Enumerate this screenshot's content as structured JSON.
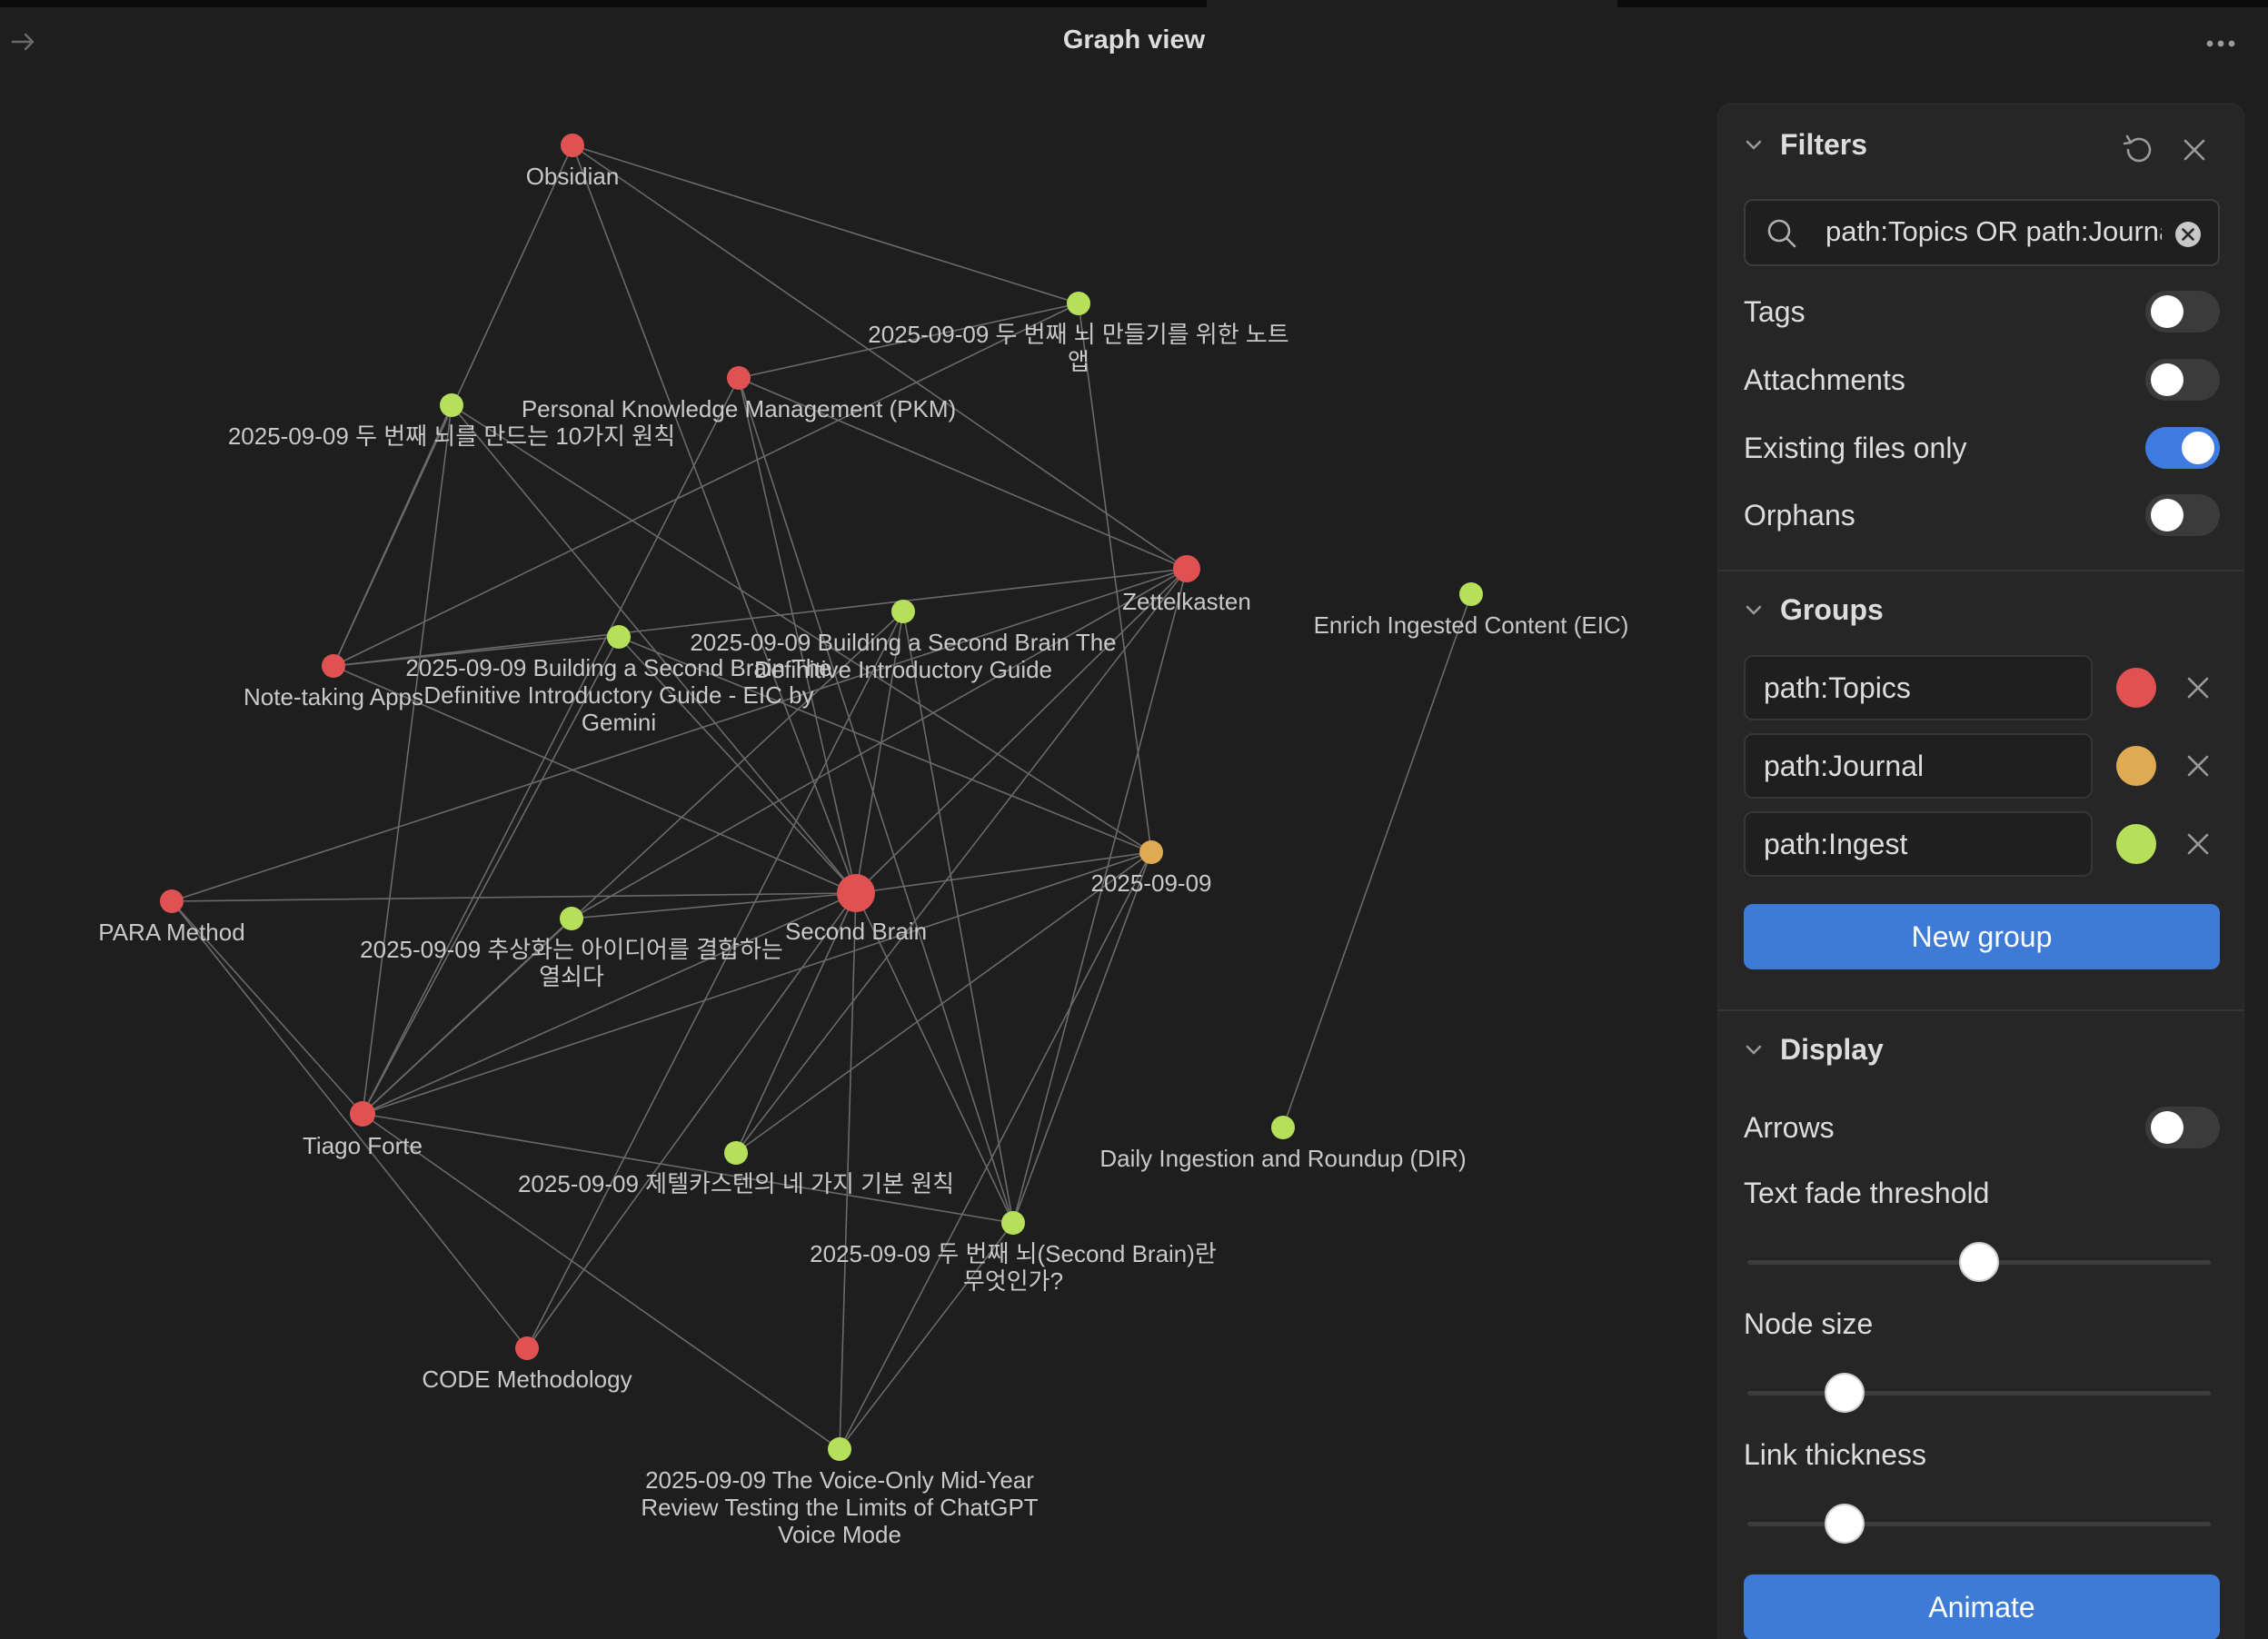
{
  "header": {
    "title": "Graph view"
  },
  "colors": {
    "topics": "#e05252",
    "journal": "#e0aa52",
    "ingest": "#b6e05a",
    "accent": "#3e7bd7",
    "edge": "#6a6a6a"
  },
  "graph": {
    "nodes": [
      {
        "id": "obsidian",
        "label": [
          "Obsidian"
        ],
        "group": "topics"
      },
      {
        "id": "second_brain_app",
        "label": [
          "2025-09-09 두 번째 뇌 만들기를 위한 노트",
          "앱"
        ],
        "group": "ingest"
      },
      {
        "id": "pkm",
        "label": [
          "Personal Knowledge Management (PKM)"
        ],
        "group": "topics"
      },
      {
        "id": "ten_principles",
        "label": [
          "2025-09-09 두 번째 뇌를 만드는 10가지 원칙"
        ],
        "group": "ingest"
      },
      {
        "id": "zettelkasten",
        "label": [
          "Zettelkasten"
        ],
        "group": "topics"
      },
      {
        "id": "eic",
        "label": [
          "Enrich Ingested Content (EIC)"
        ],
        "group": "ingest"
      },
      {
        "id": "bsb_intro",
        "label": [
          "2025-09-09 Building a Second Brain The",
          "Definitive Introductory Guide"
        ],
        "group": "ingest"
      },
      {
        "id": "bsb_gemini",
        "label": [
          "2025-09-09 Building a Second Brain The",
          "Definitive Introductory Guide - EIC by",
          "Gemini"
        ],
        "group": "ingest"
      },
      {
        "id": "note_taking_apps",
        "label": [
          "Note-taking Apps"
        ],
        "group": "topics"
      },
      {
        "id": "journal_0909",
        "label": [
          "2025-09-09"
        ],
        "group": "journal"
      },
      {
        "id": "para",
        "label": [
          "PARA Method"
        ],
        "group": "topics"
      },
      {
        "id": "abstract_ideas",
        "label": [
          "2025-09-09 추상화는 아이디어를 결합하는",
          "열쇠다"
        ],
        "group": "ingest"
      },
      {
        "id": "second_brain",
        "label": [
          "Second Brain"
        ],
        "group": "topics"
      },
      {
        "id": "tiago",
        "label": [
          "Tiago Forte"
        ],
        "group": "topics"
      },
      {
        "id": "dir",
        "label": [
          "Daily Ingestion and Roundup (DIR)"
        ],
        "group": "ingest"
      },
      {
        "id": "four_principles",
        "label": [
          "2025-09-09 제텔카스텐의 네 가지 기본 원칙"
        ],
        "group": "ingest"
      },
      {
        "id": "what_is_sb",
        "label": [
          "2025-09-09 두 번째 뇌(Second Brain)란",
          "무엇인가?"
        ],
        "group": "ingest"
      },
      {
        "id": "code",
        "label": [
          "CODE Methodology"
        ],
        "group": "topics"
      },
      {
        "id": "voice_review",
        "label": [
          "2025-09-09 The Voice-Only Mid-Year",
          "Review Testing the Limits of ChatGPT",
          "Voice Mode"
        ],
        "group": "ingest"
      }
    ],
    "edges": [
      [
        "obsidian",
        "second_brain_app"
      ],
      [
        "obsidian",
        "zettelkasten"
      ],
      [
        "obsidian",
        "note_taking_apps"
      ],
      [
        "obsidian",
        "second_brain"
      ],
      [
        "second_brain_app",
        "pkm"
      ],
      [
        "second_brain_app",
        "note_taking_apps"
      ],
      [
        "second_brain_app",
        "journal_0909"
      ],
      [
        "pkm",
        "zettelkasten"
      ],
      [
        "pkm",
        "second_brain"
      ],
      [
        "pkm",
        "what_is_sb"
      ],
      [
        "ten_principles",
        "note_taking_apps"
      ],
      [
        "ten_principles",
        "second_brain"
      ],
      [
        "ten_principles",
        "tiago"
      ],
      [
        "ten_principles",
        "journal_0909"
      ],
      [
        "zettelkasten",
        "note_taking_apps"
      ],
      [
        "zettelkasten",
        "second_brain"
      ],
      [
        "zettelkasten",
        "abstract_ideas"
      ],
      [
        "zettelkasten",
        "four_principles"
      ],
      [
        "zettelkasten",
        "what_is_sb"
      ],
      [
        "eic",
        "dir"
      ],
      [
        "bsb_intro",
        "second_brain"
      ],
      [
        "bsb_intro",
        "tiago"
      ],
      [
        "bsb_intro",
        "code"
      ],
      [
        "bsb_intro",
        "what_is_sb"
      ],
      [
        "bsb_gemini",
        "second_brain"
      ],
      [
        "bsb_gemini",
        "tiago"
      ],
      [
        "bsb_gemini",
        "journal_0909"
      ],
      [
        "bsb_gemini",
        "note_taking_apps"
      ],
      [
        "note_taking_apps",
        "second_brain"
      ],
      [
        "journal_0909",
        "second_brain"
      ],
      [
        "journal_0909",
        "four_principles"
      ],
      [
        "journal_0909",
        "what_is_sb"
      ],
      [
        "journal_0909",
        "voice_review"
      ],
      [
        "journal_0909",
        "tiago"
      ],
      [
        "para",
        "second_brain"
      ],
      [
        "para",
        "tiago"
      ],
      [
        "para",
        "code"
      ],
      [
        "para",
        "zettelkasten"
      ],
      [
        "abstract_ideas",
        "second_brain"
      ],
      [
        "abstract_ideas",
        "tiago"
      ],
      [
        "second_brain",
        "tiago"
      ],
      [
        "second_brain",
        "code"
      ],
      [
        "second_brain",
        "voice_review"
      ],
      [
        "second_brain",
        "what_is_sb"
      ],
      [
        "second_brain",
        "four_principles"
      ],
      [
        "tiago",
        "voice_review"
      ],
      [
        "tiago",
        "what_is_sb"
      ],
      [
        "tiago",
        "pkm"
      ],
      [
        "what_is_sb",
        "voice_review"
      ]
    ]
  },
  "filters": {
    "title": "Filters",
    "search_value": "path:Topics  OR path:Journal",
    "tags_label": "Tags",
    "tags_on": false,
    "attachments_label": "Attachments",
    "attachments_on": false,
    "existing_label": "Existing files only",
    "existing_on": true,
    "orphans_label": "Orphans",
    "orphans_on": false
  },
  "groups": {
    "title": "Groups",
    "items": [
      {
        "query": "path:Topics",
        "color": "#e05252"
      },
      {
        "query": "path:Journal",
        "color": "#e0aa52"
      },
      {
        "query": "path:Ingest",
        "color": "#b6e05a"
      }
    ],
    "new_group_label": "New group"
  },
  "display": {
    "title": "Display",
    "arrows_label": "Arrows",
    "arrows_on": false,
    "text_fade_label": "Text fade threshold",
    "text_fade_value": 0.5,
    "node_size_label": "Node size",
    "node_size_value": 0.21,
    "link_thickness_label": "Link thickness",
    "link_thickness_value": 0.21,
    "animate_label": "Animate"
  }
}
